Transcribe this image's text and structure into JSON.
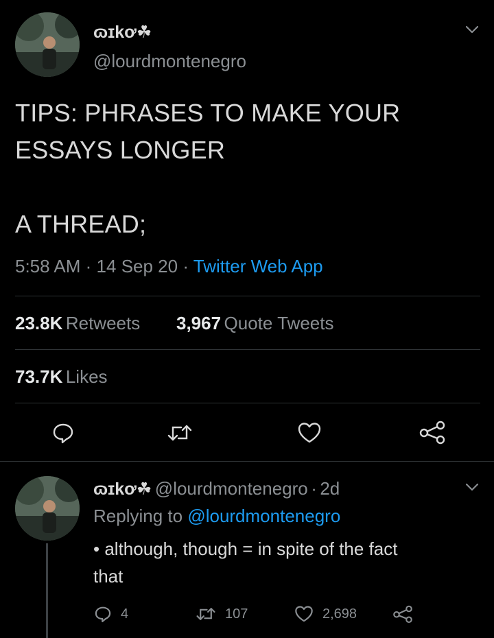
{
  "tweet": {
    "author_name": "ɷɪkơ☘",
    "author_handle": "@lourdmontenegro",
    "text_line1": "TIPS: PHRASES TO MAKE YOUR",
    "text_line2": "ESSAYS LONGER",
    "text_line3": "A THREAD;",
    "time": "5:58 AM",
    "date": "14 Sep 20",
    "source": "Twitter Web App",
    "retweets_count": "23.8K",
    "retweets_label": "Retweets",
    "quotes_count": "3,967",
    "quotes_label": "Quote Tweets",
    "likes_count": "73.7K",
    "likes_label": "Likes"
  },
  "reply": {
    "author_name": "ɷɪkơ☘",
    "author_handle": "@lourdmontenegro",
    "age": "2d",
    "replying_prefix": "Replying to",
    "replying_to": "@lourdmontenegro",
    "text_line1": "• although, though = in spite of the fact",
    "text_line2": "that",
    "reply_count": "4",
    "retweet_count": "107",
    "like_count": "2,698"
  },
  "separators": {
    "dot": "·"
  },
  "colors": {
    "background": "#000000",
    "text": "#d9d9d9",
    "muted": "#8b8f93",
    "link": "#1d9bf0",
    "divider": "#2f3336"
  },
  "icons": [
    "chevron-down-icon",
    "reply-icon",
    "retweet-icon",
    "like-icon",
    "share-icon"
  ]
}
